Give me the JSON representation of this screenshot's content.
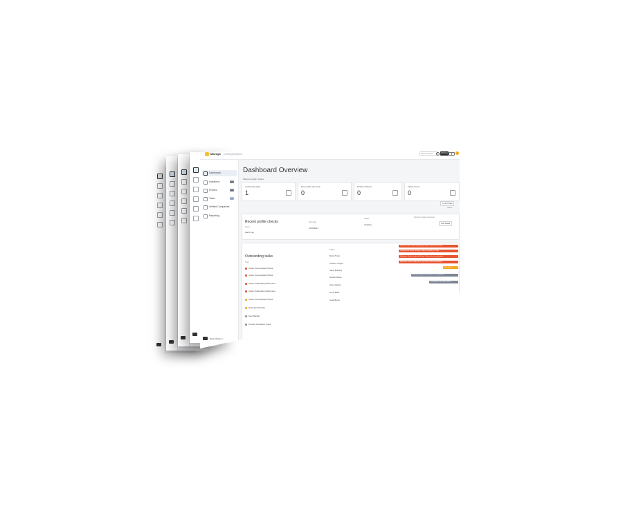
{
  "app": {
    "brand": "Mavega",
    "breadcrumb": "Getting/Started",
    "search_placeholder": "Search Profiles",
    "primary_button": "Add New"
  },
  "sidebar": {
    "items": [
      {
        "label": "Dashboard",
        "icon": "dashboard-icon",
        "active": true,
        "badge": ""
      },
      {
        "label": "Invitations",
        "icon": "invite-icon",
        "active": false,
        "badge": "0"
      },
      {
        "label": "Profiles",
        "icon": "profile-icon",
        "active": false,
        "badge": "0"
      },
      {
        "label": "Tasks",
        "icon": "task-icon",
        "active": false,
        "badge": "12"
      },
      {
        "label": "Verified Companies",
        "icon": "company-icon",
        "active": false,
        "badge": ""
      },
      {
        "label": "Reporting",
        "icon": "report-icon",
        "active": false,
        "badge": ""
      }
    ],
    "footer_label": "Back Platform"
  },
  "main": {
    "title": "Dashboard Overview",
    "welcome": "Welcome back, Sasha",
    "kpis": [
      {
        "label": "Outstanding tasks",
        "value": "1",
        "icon": "pencil-icon"
      },
      {
        "label": "New profiles this week",
        "value": "0",
        "icon": "chat-icon"
      },
      {
        "label": "Profile invitations",
        "value": "0",
        "icon": "document-icon"
      },
      {
        "label": "Failed checks",
        "value": "0",
        "icon": "bookmark-icon"
      }
    ],
    "filter_button": "Go to Profiles",
    "filter_note": "Status",
    "recent_checks": {
      "title": "Recent profile checks",
      "columns": [
        "Name",
        "Start date",
        "Status",
        "Sorted by date processed"
      ],
      "rows": [
        {
          "name": "Alanz Ivey",
          "date": "12/03/2021",
          "status": "Awaiting",
          "action": "View Details"
        }
      ]
    },
    "outstanding_tasks": {
      "title": "Outstanding tasks",
      "columns": [
        "Task",
        "Status"
      ],
      "rows": [
        {
          "task": "Check Uncompleted Profiles",
          "owner": "Maria Thorp",
          "pill": "Task. Due soon, status overdue by 14 days. Please take action",
          "color": "#e8542f"
        },
        {
          "task": "Check Uncompleted Profiles",
          "owner": "Caroline Jorgen",
          "pill": "Overdue task. Needs attention. Status: overdue by 9 days",
          "color": "#e8542f"
        },
        {
          "task": "Check Outstanding References",
          "owner": "Steve Bramley",
          "pill": "Reference Check overdue by 3 days. Please chase outstanding",
          "color": "#e8542f"
        },
        {
          "task": "Check Outstanding References",
          "owner": "Martha Wilson",
          "pill": "Reference Check overdue by 1 day. Please chase outstanding",
          "color": "#e8542f"
        },
        {
          "task": "Check Uncompleted Profiles",
          "owner": "Helen Adams",
          "pill": "Due today",
          "color": "#f2a91e"
        },
        {
          "task": "Reassign My Tasks",
          "owner": "Sonia Miller",
          "pill": "Awaiting approval from admin for reassignment",
          "color": "#7c8595"
        },
        {
          "task": "Send Mailing",
          "owner": "Linda Byrne",
          "pill": "Scheduled: next week mailout",
          "color": "#7c8595"
        },
        {
          "task": "Provide Translation Quote",
          "owner": "",
          "pill": "",
          "color": ""
        }
      ]
    }
  }
}
